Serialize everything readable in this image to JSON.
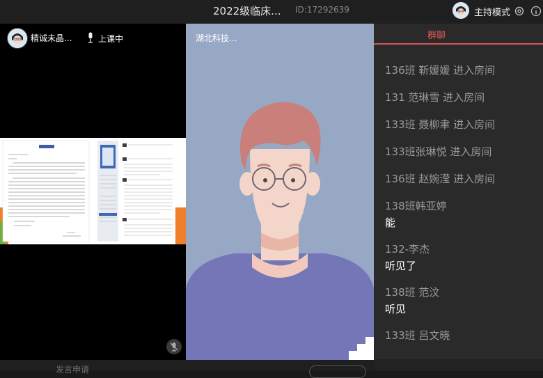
{
  "window": {
    "title": "2022级临床...",
    "room_id": "ID:17292639",
    "host_mode_label": "主持模式"
  },
  "teacher": {
    "name": "精诚未晶...",
    "status": "上课中"
  },
  "student_video": {
    "name": "湖北科技..."
  },
  "chat": {
    "tab_label": "群聊",
    "entries": [
      {
        "sender": "136班 靳媛媛 进入房间",
        "message": ""
      },
      {
        "sender": "131  范琳雪 进入房间",
        "message": ""
      },
      {
        "sender": "133班 聂柳聿 进入房间",
        "message": ""
      },
      {
        "sender": "133班张琳悦 进入房间",
        "message": ""
      },
      {
        "sender": "136班 赵婉滢 进入房间",
        "message": ""
      },
      {
        "sender": "138班韩亚婷",
        "message": "能"
      },
      {
        "sender": "132-李杰",
        "message": "听见了"
      },
      {
        "sender": "138班 范汶",
        "message": "听见"
      },
      {
        "sender": "133班 吕文晓",
        "message": ""
      }
    ]
  },
  "bottom_bar": {
    "input_text": "发言申请"
  },
  "colors": {
    "accent": "#d2504f",
    "panel_bg": "#2a2a2a",
    "video_bg": "#97a8c4"
  }
}
